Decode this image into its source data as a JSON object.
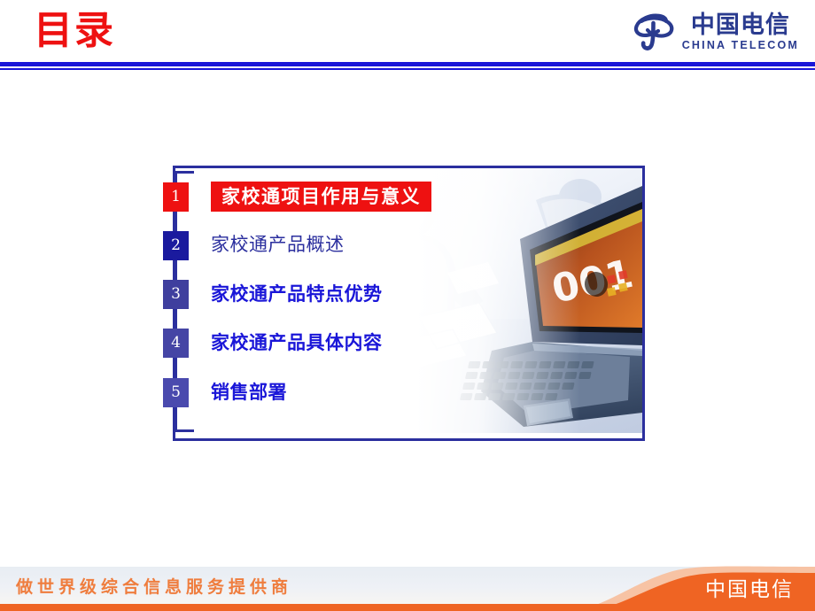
{
  "header": {
    "title": "目录",
    "title_color": "#ee1111",
    "rule_color": "#1a16d8",
    "logo": {
      "mark_name": "china-telecom-swirl-icon",
      "cn_text": "中国电信",
      "en_text": "CHINA TELECOM",
      "color": "#2a3b8f"
    }
  },
  "toc": {
    "spine_color": "#2b2f9e",
    "items": [
      {
        "number": "1",
        "label": "家校通项目作用与意义",
        "box_color": "#ee1111",
        "style": "highlight"
      },
      {
        "number": "2",
        "label": "家校通产品概述",
        "box_color": "#1a1a9e",
        "style": "plain-light"
      },
      {
        "number": "3",
        "label": "家校通产品特点优势",
        "box_color": "#3f3f9e",
        "style": "plain-bold"
      },
      {
        "number": "4",
        "label": "家校通产品具体内容",
        "box_color": "#4545a5",
        "style": "plain-bold"
      },
      {
        "number": "5",
        "label": "销售部署",
        "box_color": "#4a4aae",
        "style": "plain-bold"
      }
    ]
  },
  "content_box": {
    "border_color": "#2b2f9e",
    "photo_caption": "办公场景图：人物与笔记本电脑",
    "laptop_screen_text": "001"
  },
  "footer": {
    "slogan": "做世界级综合信息服务提供商",
    "slogan_color": "#ef7d3e",
    "brand": "中国电信",
    "band_color": "#ef6423",
    "band_accent_color": "#f9c6a6"
  }
}
